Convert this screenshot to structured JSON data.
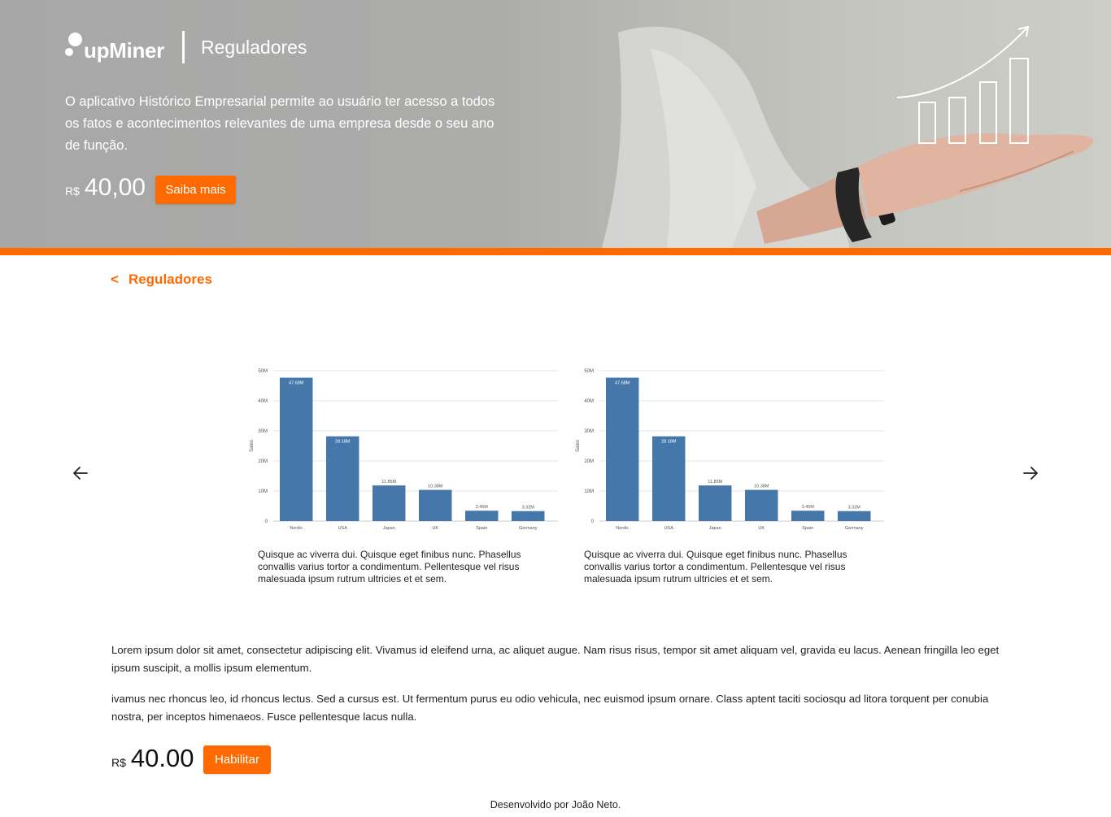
{
  "hero": {
    "brand_name": "upMiner",
    "page_name": "Reguladores",
    "description": "O aplicativo Histórico Empresarial permite ao usuário ter acesso a todos os fatos e acontecimentos relevantes de uma empresa desde o seu ano de função.",
    "price_currency": "R$",
    "price_amount": "40,00",
    "cta_label": "Saiba mais"
  },
  "nav": {
    "back_label": "Reguladores"
  },
  "icons": {
    "back": "chevron-left-icon",
    "prev": "arrow-left-icon",
    "next": "arrow-right-icon",
    "hero_art": "growth-chart-icon"
  },
  "colors": {
    "accent": "#ff6a00",
    "bar": "#4677ab"
  },
  "carousel": {
    "slides": [
      {
        "caption": "Quisque ac viverra dui. Quisque eget finibus nunc. Phasellus convallis varius tortor a condimentum. Pellentesque vel risus malesuada ipsum rutrum ultricies et et sem."
      },
      {
        "caption": "Quisque ac viverra dui. Quisque eget finibus nunc. Phasellus convallis varius tortor a condimentum. Pellentesque vel risus malesuada ipsum rutrum ultricies et et sem."
      }
    ]
  },
  "chart_data": [
    {
      "type": "bar",
      "categories": [
        "Nordic",
        "USA",
        "Japan",
        "UK",
        "Spain",
        "Germany"
      ],
      "values": [
        47.68,
        28.18,
        11.85,
        10.38,
        3.45,
        3.32
      ],
      "data_labels": [
        "47.68M",
        "28.18M",
        "11.85M",
        "10.38M",
        "3.45M",
        "3.32M"
      ],
      "ylabel": "Sales",
      "ylim": [
        0,
        50
      ],
      "yticks": [
        "0",
        "10M",
        "20M",
        "30M",
        "40M",
        "50M"
      ],
      "grid": true
    },
    {
      "type": "bar",
      "categories": [
        "Nordic",
        "USA",
        "Japan",
        "UK",
        "Spain",
        "Germany"
      ],
      "values": [
        47.68,
        28.18,
        11.85,
        10.38,
        3.45,
        3.32
      ],
      "data_labels": [
        "47.68M",
        "28.18M",
        "11.85M",
        "10.38M",
        "3.45M",
        "3.32M"
      ],
      "ylabel": "Sales",
      "ylim": [
        0,
        50
      ],
      "yticks": [
        "0",
        "10M",
        "20M",
        "30M",
        "40M",
        "50M"
      ],
      "grid": true
    }
  ],
  "content": {
    "paragraph_1": "Lorem ipsum dolor sit amet, consectetur adipiscing elit. Vivamus id eleifend urna, ac aliquet augue. Nam risus risus, tempor sit amet aliquam vel, gravida eu lacus. Aenean fringilla leo eget ipsum suscipit, a mollis ipsum elementum.",
    "paragraph_2": "ivamus nec rhoncus leo, id rhoncus lectus. Sed a cursus est. Ut fermentum purus eu odio vehicula, nec euismod ipsum ornare. Class aptent taciti sociosqu ad litora torquent per conubia nostra, per inceptos himenaeos. Fusce pellentesque lacus nulla.",
    "price_currency": "R$",
    "price_amount": "40.00",
    "enable_label": "Habilitar"
  },
  "footer": {
    "credit": "Desenvolvido por João Neto."
  }
}
